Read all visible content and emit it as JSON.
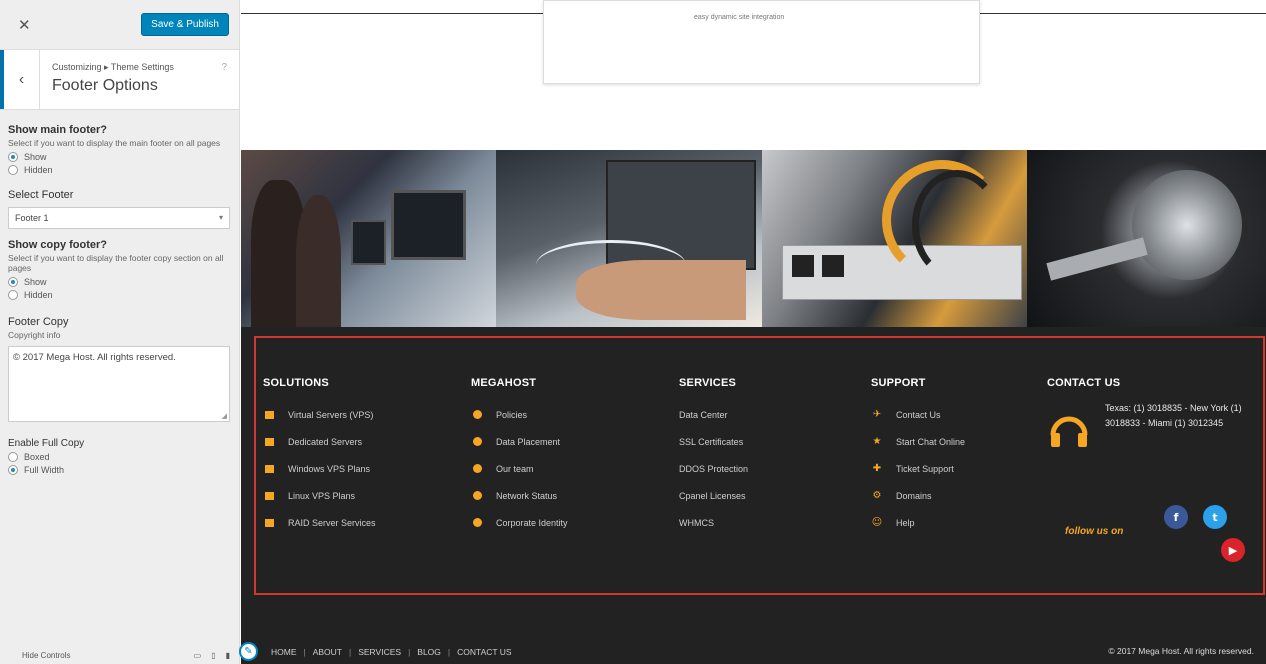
{
  "panel": {
    "close_glyph": "✕",
    "publish_label": "Save & Publish",
    "breadcrumb": "Customizing ▸ Theme Settings",
    "help_glyph": "?",
    "section_title": "Footer Options",
    "show_main_footer": {
      "title": "Show main footer?",
      "desc": "Select if you want to display the main footer on all pages",
      "options": [
        "Show",
        "Hidden"
      ],
      "selected": 0
    },
    "select_footer": {
      "title": "Select Footer",
      "value": "Footer 1"
    },
    "show_copy_footer": {
      "title": "Show copy footer?",
      "desc": "Select if you want to display the footer copy section on all pages",
      "options": [
        "Show",
        "Hidden"
      ],
      "selected": 0
    },
    "footer_copy": {
      "title": "Footer Copy",
      "desc": "Copyright info",
      "value": "© 2017 Mega Host. All rights reserved."
    },
    "width": {
      "title": "Enable Full Copy",
      "options": [
        "Boxed",
        "Full Width"
      ],
      "selected": 1
    },
    "foot_label": "Hide Controls"
  },
  "preview": {
    "card_text": "easy dynamic site integration",
    "footer": {
      "columns": [
        {
          "title": "SOLUTIONS",
          "icon": "square-icon",
          "items": [
            "Virtual Servers (VPS)",
            "Dedicated Servers",
            "Windows VPS Plans",
            "Linux VPS Plans",
            "RAID Server Services"
          ]
        },
        {
          "title": "MEGAHOST",
          "icon": "check-circle-icon",
          "items": [
            "Policies",
            "Data Placement",
            "Our team",
            "Network Status",
            "Corporate Identity"
          ]
        },
        {
          "title": "SERVICES",
          "icon": "none",
          "items": [
            "Data Center",
            "SSL Certificates",
            "DDOS Protection",
            "Cpanel Licenses",
            "WHMCS"
          ]
        },
        {
          "title": "SUPPORT",
          "icon": "mixed",
          "items": [
            "Contact Us",
            "Start Chat Online",
            "Ticket Support",
            "Domains",
            "Help"
          ],
          "icons": [
            "✈",
            "★",
            "✚",
            "⚙",
            "☺"
          ]
        }
      ],
      "contact": {
        "title": "CONTACT US",
        "text": "Texas: (1) 3018835 - New York (1) 3018833 - Miami (1) 3012345"
      },
      "follow_label": "follow us on",
      "social": {
        "facebook": "f",
        "twitter": "t",
        "youtube": "▶"
      },
      "nav": [
        "HOME",
        "ABOUT",
        "SERVICES",
        "BLOG",
        "CONTACT US"
      ],
      "copyright": "© 2017 Mega Host. All rights reserved.",
      "accent_color": "#f5a623",
      "outline_color": "#cf3a2c"
    }
  }
}
